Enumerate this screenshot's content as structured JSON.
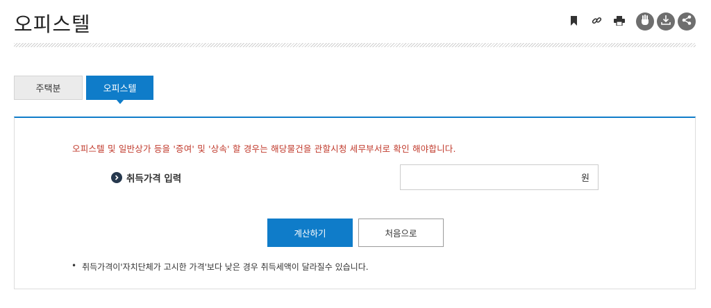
{
  "page": {
    "title": "오피스텔"
  },
  "toolbar": {
    "icons": [
      "bookmark-icon",
      "link-icon",
      "print-icon",
      "sign-language-icon",
      "download-icon",
      "share-icon"
    ]
  },
  "tabs": [
    {
      "label": "주택분",
      "active": false
    },
    {
      "label": "오피스텔",
      "active": true
    }
  ],
  "panel": {
    "warning": "오피스텔 및 일반상가 등을 '증여' 및 '상속' 할 경우는 해당물건을 관할시청 세무부서로 확인 해야합니다.",
    "acquisition_label": "취득가격 입력",
    "amount": {
      "value": "",
      "unit": "원"
    },
    "calculate_label": "계산하기",
    "reset_label": "처음으로",
    "note": "취득가격이'자치단체가 고시한 가격'보다 낮은 경우 취득세액이 달라질수 있습니다."
  },
  "colors": {
    "accent": "#0f7cc9",
    "warning": "#c0392b",
    "bullet": "#26384d",
    "tool_circle": "#6e6e6e"
  }
}
